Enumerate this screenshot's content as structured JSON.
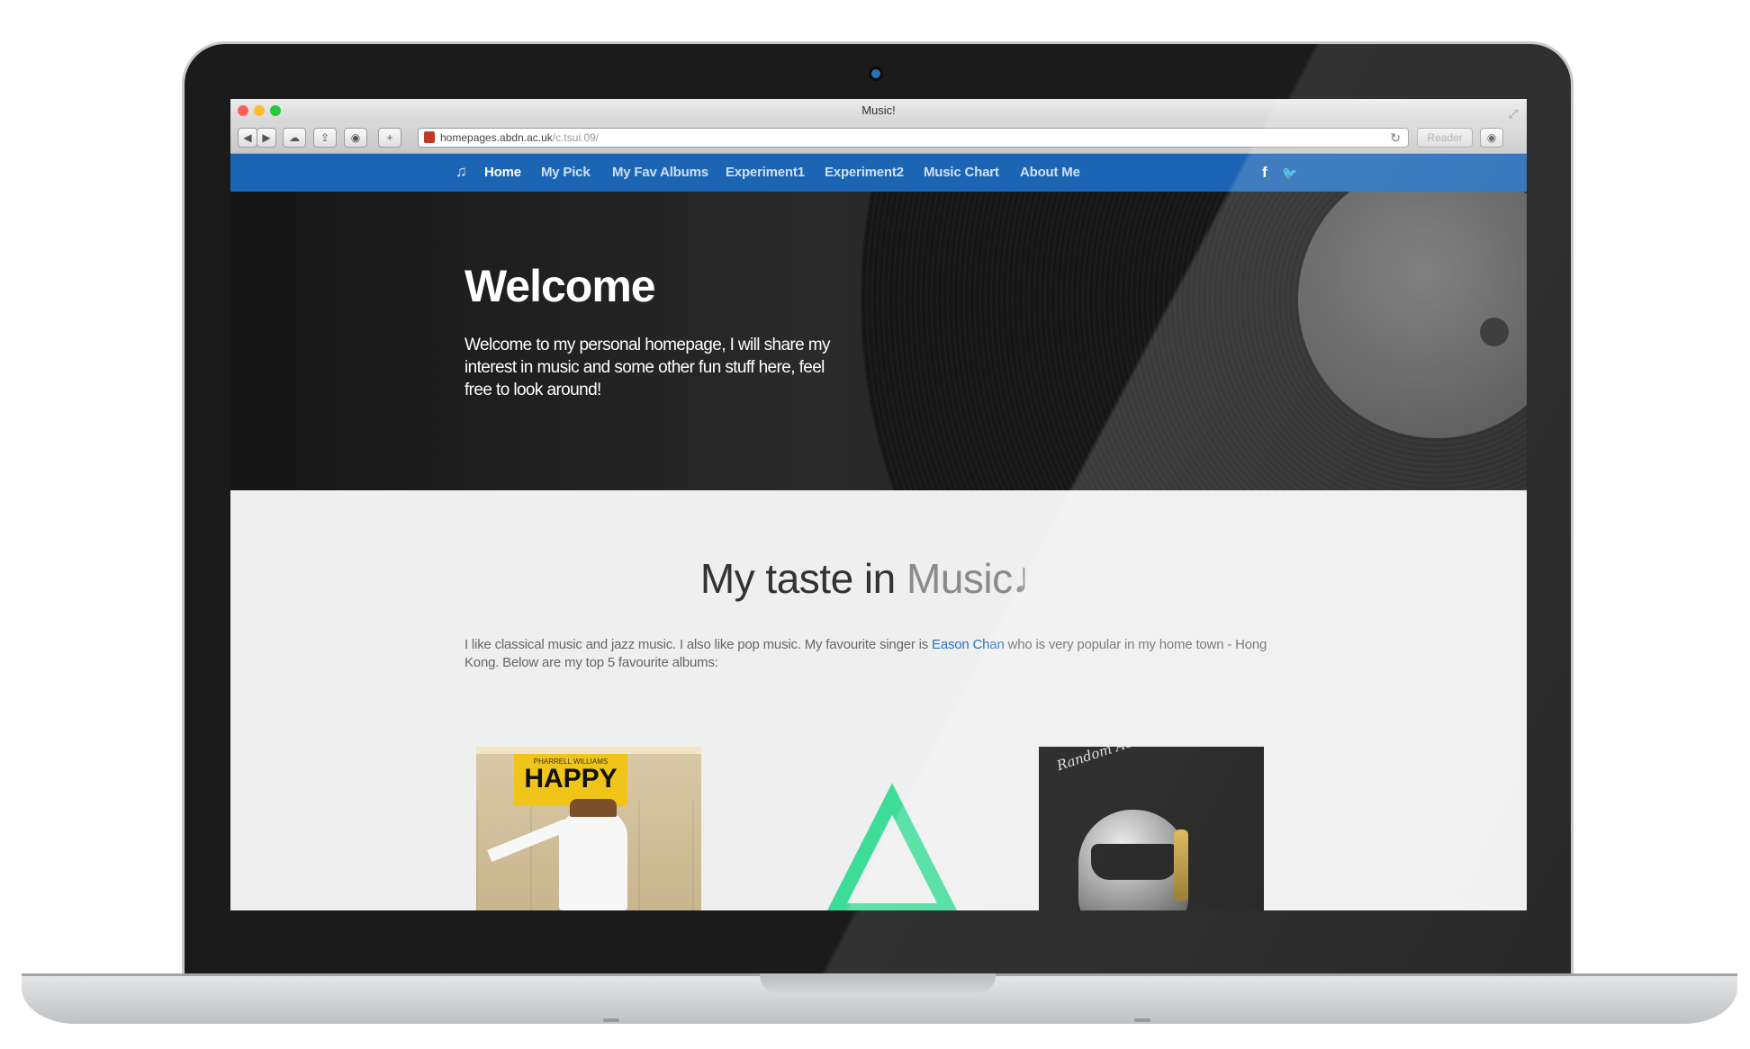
{
  "browser": {
    "window_title": "Music!",
    "url_host": "homepages.abdn.ac.uk",
    "url_path": "/c.tsui.09/",
    "reader_label": "Reader",
    "reload_glyph": "↻",
    "add_glyph": "+",
    "back_glyph": "◀",
    "forward_glyph": "▶"
  },
  "nav": {
    "brand_icon": "music-note-icon",
    "brand_glyph": "♫",
    "items": [
      {
        "label": "Home",
        "active": true
      },
      {
        "label": "My Pick",
        "active": false
      },
      {
        "label": "My Fav Albums",
        "active": false
      },
      {
        "label": "Experiment1",
        "active": false
      },
      {
        "label": "Experiment2",
        "active": false
      },
      {
        "label": "Music Chart",
        "active": false
      },
      {
        "label": "About Me",
        "active": false
      }
    ],
    "social": [
      {
        "icon": "facebook-icon",
        "glyph": "f"
      },
      {
        "icon": "twitter-icon",
        "glyph": "🐦"
      }
    ]
  },
  "hero": {
    "title": "Welcome",
    "text": "Welcome to my personal homepage, I will share my interest in music and some other fun stuff here, feel free to look around!"
  },
  "section": {
    "title_dark": "My taste in ",
    "title_light": "Music",
    "title_note": "♩",
    "para_before": "I like classical music and jazz music. I also like pop music. My favourite singer is ",
    "link": "Eason Chan",
    "para_after": " who is very popular in my home town - Hong Kong. Below are my top 5 favourite albums:"
  },
  "albums": [
    {
      "name": "happy",
      "small": "PHARRELL WILLIAMS",
      "title": "HAPPY"
    },
    {
      "name": "triangle"
    },
    {
      "name": "random-access-memories",
      "script": "Random Access Memories"
    }
  ],
  "colors": {
    "nav_blue": "#1c64b4",
    "link_blue": "#2a72c4",
    "triangle_green": "#3ddc97"
  }
}
